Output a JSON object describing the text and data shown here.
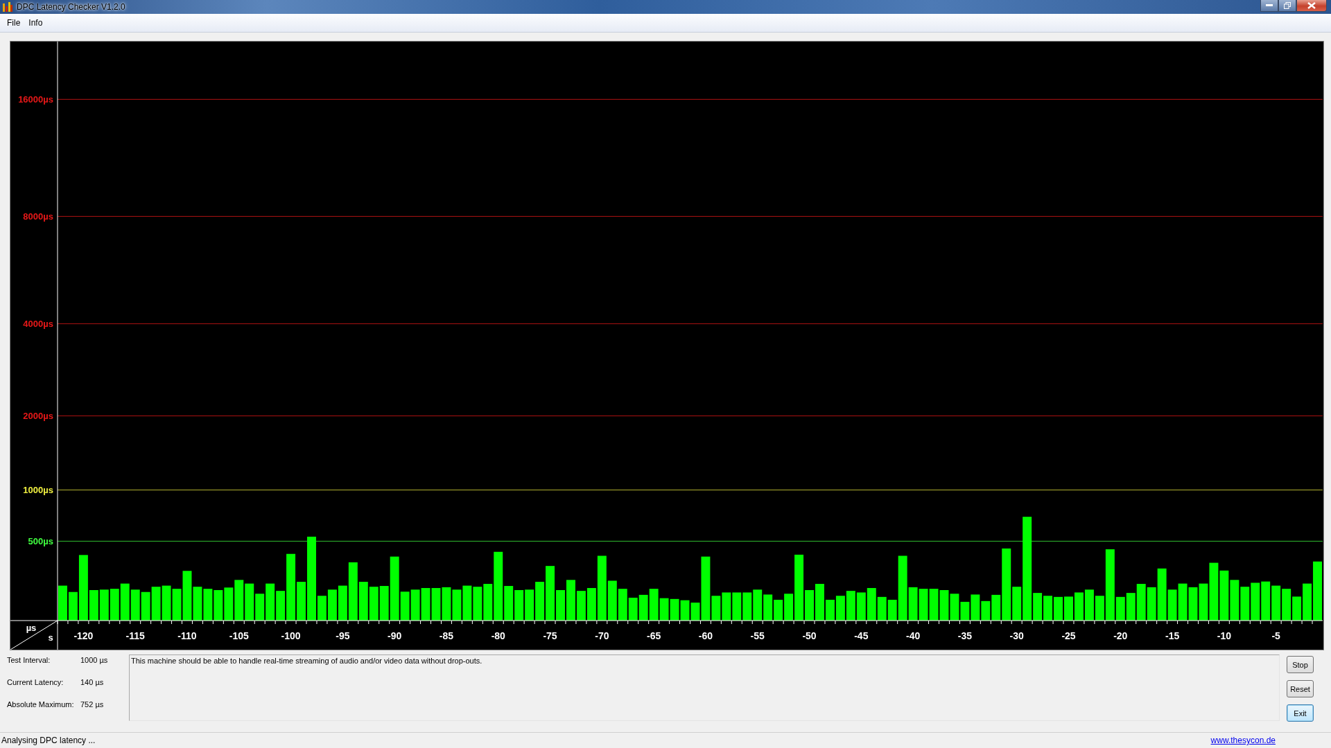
{
  "window": {
    "title": "DPC Latency Checker V1.2.0"
  },
  "menu": [
    "File",
    "Info"
  ],
  "chart": {
    "x_unit": "s",
    "y_unit": "µs",
    "x_labels": [
      "-120",
      "-115",
      "-110",
      "-105",
      "-100",
      "-95",
      "-90",
      "-85",
      "-80",
      "-75",
      "-70",
      "-65",
      "-60",
      "-55",
      "-50",
      "-45",
      "-40",
      "-35",
      "-30",
      "-25",
      "-20",
      "-15",
      "-10",
      "-5"
    ],
    "y_labels": [
      {
        "text": "16000µs",
        "color": "#e81818"
      },
      {
        "text": "8000µs",
        "color": "#e81818"
      },
      {
        "text": "4000µs",
        "color": "#e81818"
      },
      {
        "text": "2000µs",
        "color": "#e81818"
      },
      {
        "text": "1000µs",
        "color": "#f0f040"
      },
      {
        "text": "500µs",
        "color": "#40ff40"
      }
    ]
  },
  "info": [
    {
      "label": "Test Interval:",
      "value": "1000 µs"
    },
    {
      "label": "Current Latency:",
      "value": "140 µs"
    },
    {
      "label": "Absolute Maximum:",
      "value": "752 µs"
    }
  ],
  "message": "This machine should be able to handle real-time streaming of audio and/or video data without drop-outs.",
  "buttons": [
    {
      "label": "Stop",
      "default": false
    },
    {
      "label": "Reset",
      "default": false
    },
    {
      "label": "Exit",
      "default": true
    }
  ],
  "status_bar": {
    "text": "Analysing DPC latency ...",
    "link": "www.thesycon.de"
  }
}
